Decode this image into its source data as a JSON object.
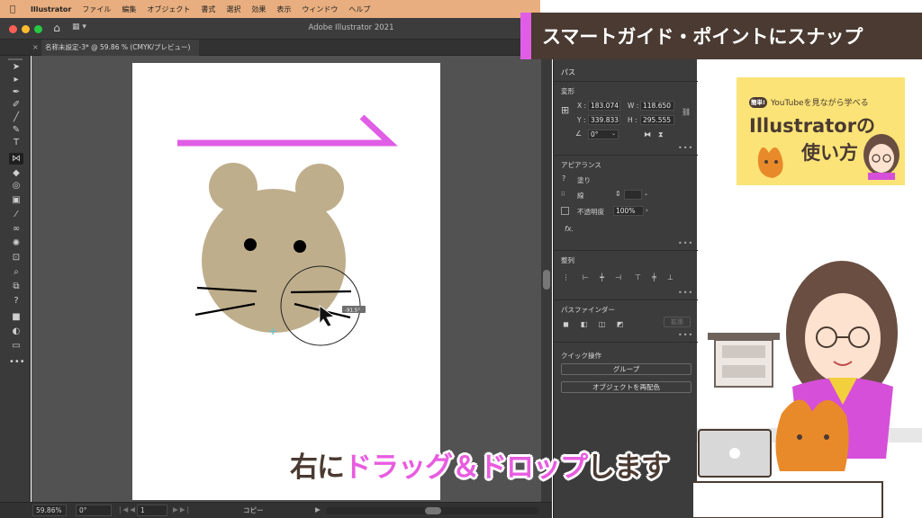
{
  "menubar": {
    "app": "Illustrator",
    "items": [
      "ファイル",
      "編集",
      "オブジェクト",
      "書式",
      "選択",
      "効果",
      "表示",
      "ウィンドウ",
      "ヘルプ"
    ]
  },
  "window": {
    "title": "Adobe Illustrator 2021",
    "doc_tab": "名称未設定-3* @ 59.86 % (CMYK/プレビュー)"
  },
  "canvas": {
    "measure_label": "-91.5°"
  },
  "statusbar": {
    "zoom": "59.86%",
    "rotation": "0°",
    "page": "1",
    "mode": "コピー"
  },
  "panel": {
    "tab": "パス",
    "transform": {
      "heading": "変形",
      "x_label": "X :",
      "x": "183.074",
      "y_label": "Y :",
      "y": "339.833",
      "w_label": "W :",
      "w": "118.650",
      "h_label": "H :",
      "h": "295.555",
      "angle": "0°"
    },
    "appearance": {
      "heading": "アピアランス",
      "fill": "塗り",
      "stroke": "線",
      "opacity_label": "不透明度",
      "opacity": "100%",
      "fx": "fx."
    },
    "align": {
      "heading": "整列"
    },
    "pathfinder": {
      "heading": "パスファインダー",
      "expand": "拡張"
    },
    "quick_actions": {
      "heading": "クイック操作",
      "group": "グループ",
      "recolor": "オブジェクトを再配色"
    }
  },
  "banner": {
    "text": "スマートガイド・ポイントにスナップ"
  },
  "logo": {
    "badge": "簡単!",
    "subtitle": "YouTubeを見ながら学べる",
    "line1": "Illustratorの",
    "line2": "使い方"
  },
  "caption": {
    "part1": "右に",
    "part2": "ドラッグ＆ドロップ",
    "part3": "します"
  },
  "colors": {
    "accent_pink": "#e05ee5",
    "banner_brown": "#4a3a31",
    "mouse_tan": "#bfae8c",
    "logo_yellow": "#fbe377"
  }
}
